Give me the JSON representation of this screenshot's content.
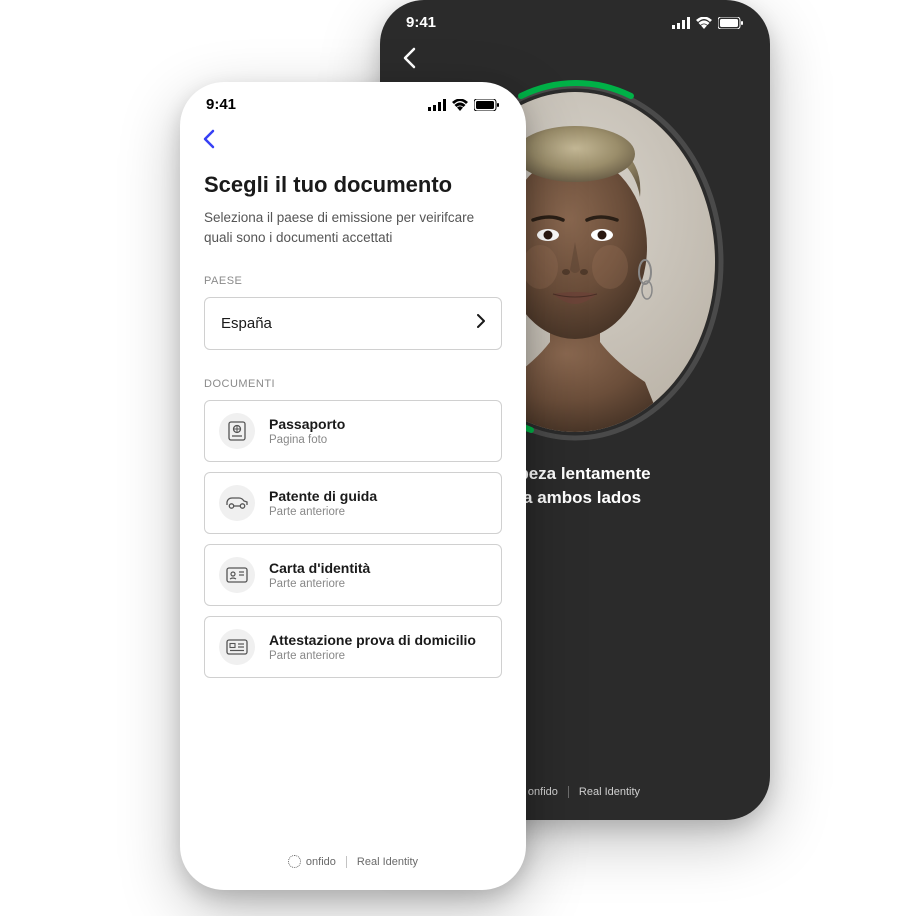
{
  "status": {
    "time": "9:41"
  },
  "light_phone": {
    "heading": "Scegli il tuo documento",
    "subheading": "Seleziona il paese di emissione per veirifcare quali sono i documenti accettati",
    "country_label": "PAESE",
    "country_value": "España",
    "documents_label": "DOCUMENTI",
    "documents": [
      {
        "title": "Passaporto",
        "subtitle": "Pagina foto"
      },
      {
        "title": "Patente di guida",
        "subtitle": "Parte anteriore"
      },
      {
        "title": "Carta d'identità",
        "subtitle": "Parte anteriore"
      },
      {
        "title": "Attestazione prova di domicilio",
        "subtitle": "Parte anteriore"
      }
    ]
  },
  "dark_phone": {
    "instruction_line1": "cabeza lentamente",
    "instruction_line2": "cia ambos lados"
  },
  "brand": {
    "name": "onfido",
    "tagline": "Real Identity"
  },
  "colors": {
    "accent_blue": "#3640f5",
    "progress_green": "#00b147",
    "dark_bg": "#2b2b2b"
  }
}
